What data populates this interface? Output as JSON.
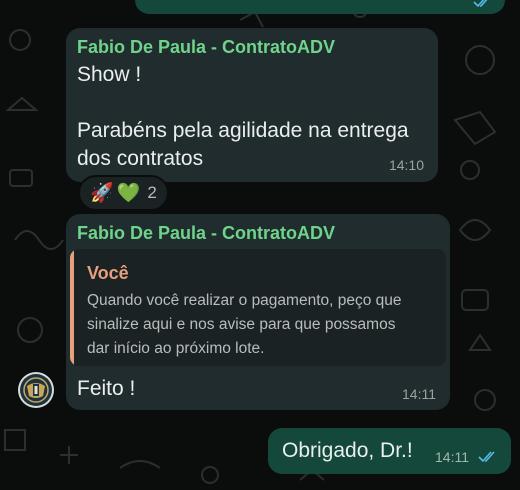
{
  "colors": {
    "background": "#0b0d0c",
    "incoming_bubble": "#202c2d",
    "outgoing_bubble": "#13483a",
    "sender_name": "#6fd48b",
    "quote_accent": "#e6a07c",
    "read_ticks": "#53bdeb"
  },
  "messages": [
    {
      "sender": "Fabio De Paula - ContratoADV",
      "lines": [
        "Show !",
        "",
        "Parabéns pela agilidade na entrega",
        "dos contratos"
      ],
      "time": "14:10",
      "reactions": {
        "emojis": [
          "🚀",
          "💚"
        ],
        "count": "2"
      }
    },
    {
      "sender": "Fabio De Paula - ContratoADV",
      "quote": {
        "author": "Você",
        "lines": [
          "Quando você realizar o pagamento, peço que",
          "sinalize aqui e nos avise para que possamos",
          "dar início ao próximo lote."
        ]
      },
      "text": "Feito !",
      "time": "14:11"
    }
  ],
  "outgoing": {
    "text": "Obrigado, Dr.!",
    "time": "14:11",
    "status_icon": "double-check-read-icon"
  },
  "top_bubble": {
    "status_icon": "double-check-read-icon"
  },
  "avatar_icon": "law-firm-logo-icon"
}
